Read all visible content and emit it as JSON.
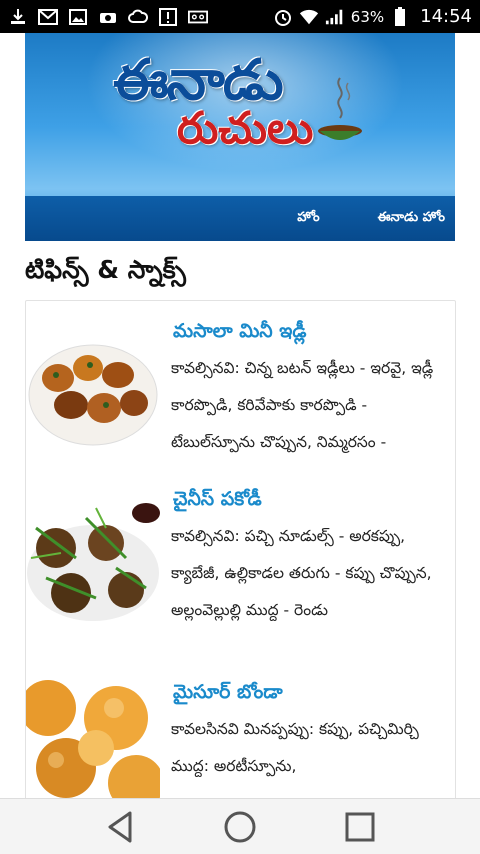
{
  "status_bar": {
    "battery": "63%",
    "time": "14:54",
    "icons": [
      "download-icon",
      "gmail-icon",
      "gallery-icon",
      "camera-icon",
      "cloud-icon",
      "alert-icon",
      "voicemail-icon",
      "alarm-icon",
      "wifi-icon",
      "signal-icon",
      "battery-icon"
    ]
  },
  "banner": {
    "brand_top": "ఈనాడు",
    "brand_bottom": "రుచులు",
    "nav": [
      {
        "label": "హోం"
      },
      {
        "label": "ఈనాడు హోం"
      }
    ]
  },
  "section": {
    "title": "టిఫిన్స్ & స్నాక్స్"
  },
  "items": [
    {
      "title": "మసాలా మినీ ఇడ్లీ",
      "desc": "కావల్సినవి: చిన్న బటన్ ఇడ్లీలు - ఇరవై, ఇడ్లీ కారప్పొడి, కరివేపాకు కారప్పొడి - టేబుల్‌స్పూను చొప్పున, నిమ్మరసం -"
    },
    {
      "title": "చైనీస్ పకోడీ",
      "desc": "కావల్సినవి: పచ్చి నూడుల్స్ - అరకప్పు, క్యాబేజీ, ఉల్లికాడల తరుగు - కప్పు చొప్పున, అల్లంవెల్లుల్లి ముద్ద - రెండు"
    },
    {
      "title": "మైసూర్ బోండా",
      "desc": "కావలసినవి మినప్పప్పు: కప్పు, పచ్చిమిర్చి ముద్ద: అరటీస్పూను,"
    }
  ],
  "navigation": {
    "buttons": [
      "back",
      "home",
      "recents"
    ]
  },
  "colors": {
    "link": "#1a8acb",
    "banner_nav": "#0e5ea8",
    "brand_blue": "#0b4d9a",
    "brand_red": "#d01f1f"
  }
}
